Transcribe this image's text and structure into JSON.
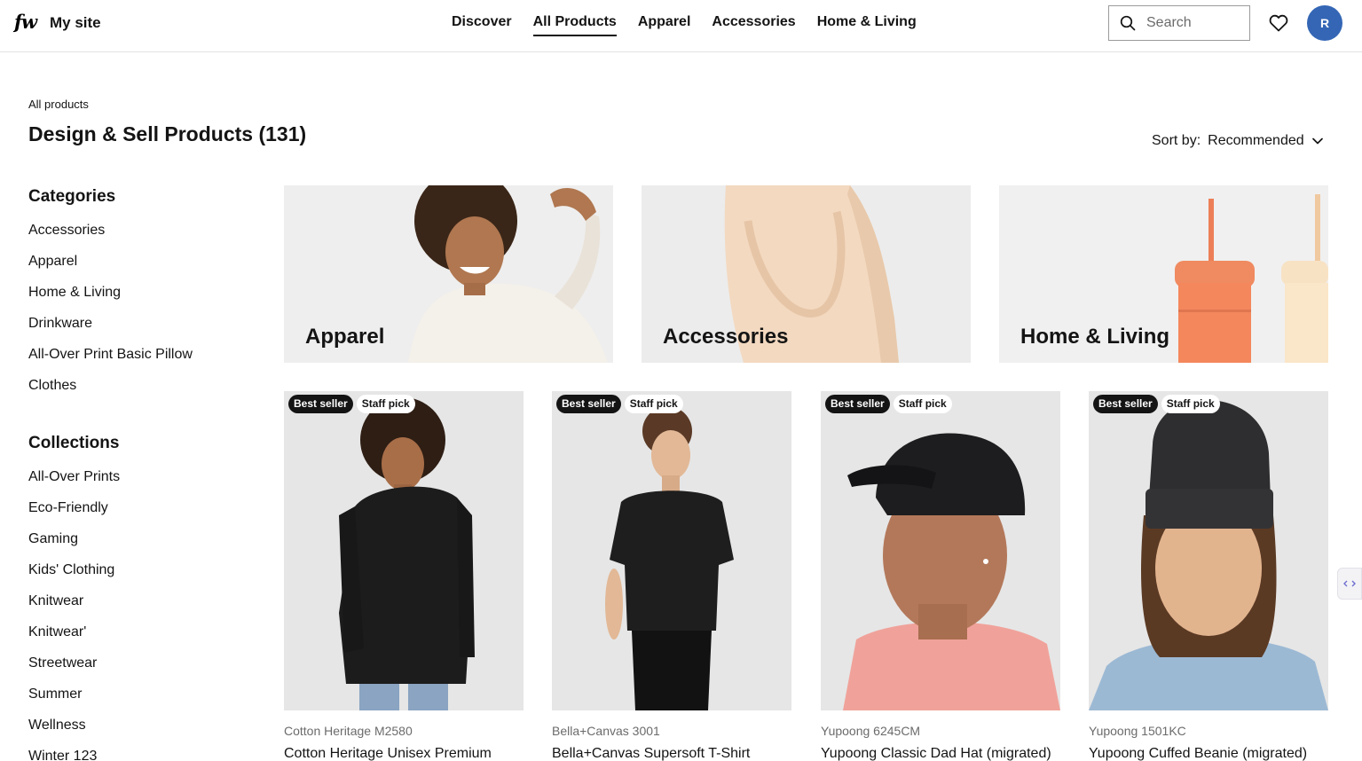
{
  "header": {
    "logo": "fw",
    "site_name": "My site",
    "nav": [
      "Discover",
      "All Products",
      "Apparel",
      "Accessories",
      "Home & Living"
    ],
    "active_nav": "All Products",
    "search_placeholder": "Search",
    "avatar_initial": "R"
  },
  "page": {
    "breadcrumb": "All products",
    "title": "Design & Sell Products (131)",
    "sort_label": "Sort by:",
    "sort_value": "Recommended"
  },
  "sidebar": {
    "categories_heading": "Categories",
    "categories": [
      "Accessories",
      "Apparel",
      "Home & Living",
      "Drinkware",
      "All-Over Print Basic Pillow",
      "Clothes"
    ],
    "collections_heading": "Collections",
    "collections": [
      "All-Over Prints",
      "Eco-Friendly",
      "Gaming",
      "Kids' Clothing",
      "Knitwear",
      "Knitwear'",
      "Streetwear",
      "Summer",
      "Wellness",
      "Winter 123"
    ]
  },
  "banners": [
    {
      "label": "Apparel"
    },
    {
      "label": "Accessories"
    },
    {
      "label": "Home & Living"
    }
  ],
  "products": [
    {
      "brand": "Cotton Heritage M2580",
      "name": "Cotton Heritage Unisex Premium",
      "badges": [
        "Best seller",
        "Staff pick"
      ]
    },
    {
      "brand": "Bella+Canvas 3001",
      "name": "Bella+Canvas Supersoft T-Shirt",
      "badges": [
        "Best seller",
        "Staff pick"
      ]
    },
    {
      "brand": "Yupoong 6245CM",
      "name": "Yupoong Classic Dad Hat (migrated)",
      "badges": [
        "Best seller",
        "Staff pick"
      ]
    },
    {
      "brand": "Yupoong 1501KC",
      "name": "Yupoong Cuffed Beanie (migrated)",
      "badges": [
        "Best seller",
        "Staff pick"
      ]
    }
  ],
  "colors": {
    "text": "#141414",
    "avatar": "#3466b5",
    "muted": "#6b6b6b"
  }
}
